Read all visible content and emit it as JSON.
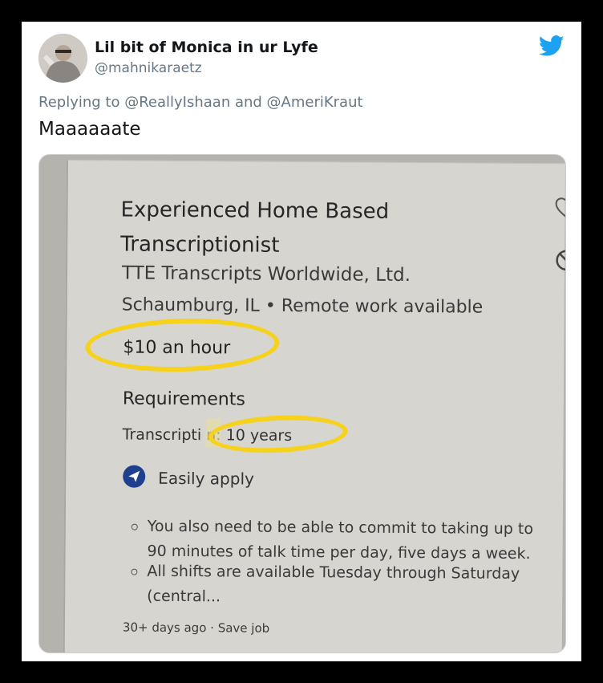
{
  "tweet": {
    "user_name": "Lil bit of Monica in ur Lyfe",
    "handle": "@mahnikaraetz",
    "replying_to": "Replying to @ReallyIshaan and @AmeriKraut",
    "text": "Maaaaaate"
  },
  "job_listing": {
    "title_line1": "Experienced Home Based",
    "title_line2": "Transcriptionist",
    "company": "TTE Transcripts Worldwide, Ltd.",
    "location": "Schaumburg, IL  •  Remote work available",
    "salary": "$10 an hour",
    "requirements_heading": "Requirements",
    "requirement": "Transcripti  n: 10 years",
    "easily_apply": "Easily apply",
    "bullets": [
      "You also need to be able to commit to taking up to 90 minutes of talk time per day, five days a week.",
      "All shifts are available Tuesday through Saturday (central..."
    ],
    "meta": "30+ days ago  ·  Save job"
  },
  "icons": {
    "platform": "twitter-bird-icon",
    "save": "heart-icon",
    "not_interested": "ban-icon",
    "apply": "paper-plane-icon"
  },
  "colors": {
    "twitter_blue": "#1da1f2",
    "highlight_yellow": "#f7d21d",
    "apply_badge": "#1f3f8f"
  }
}
